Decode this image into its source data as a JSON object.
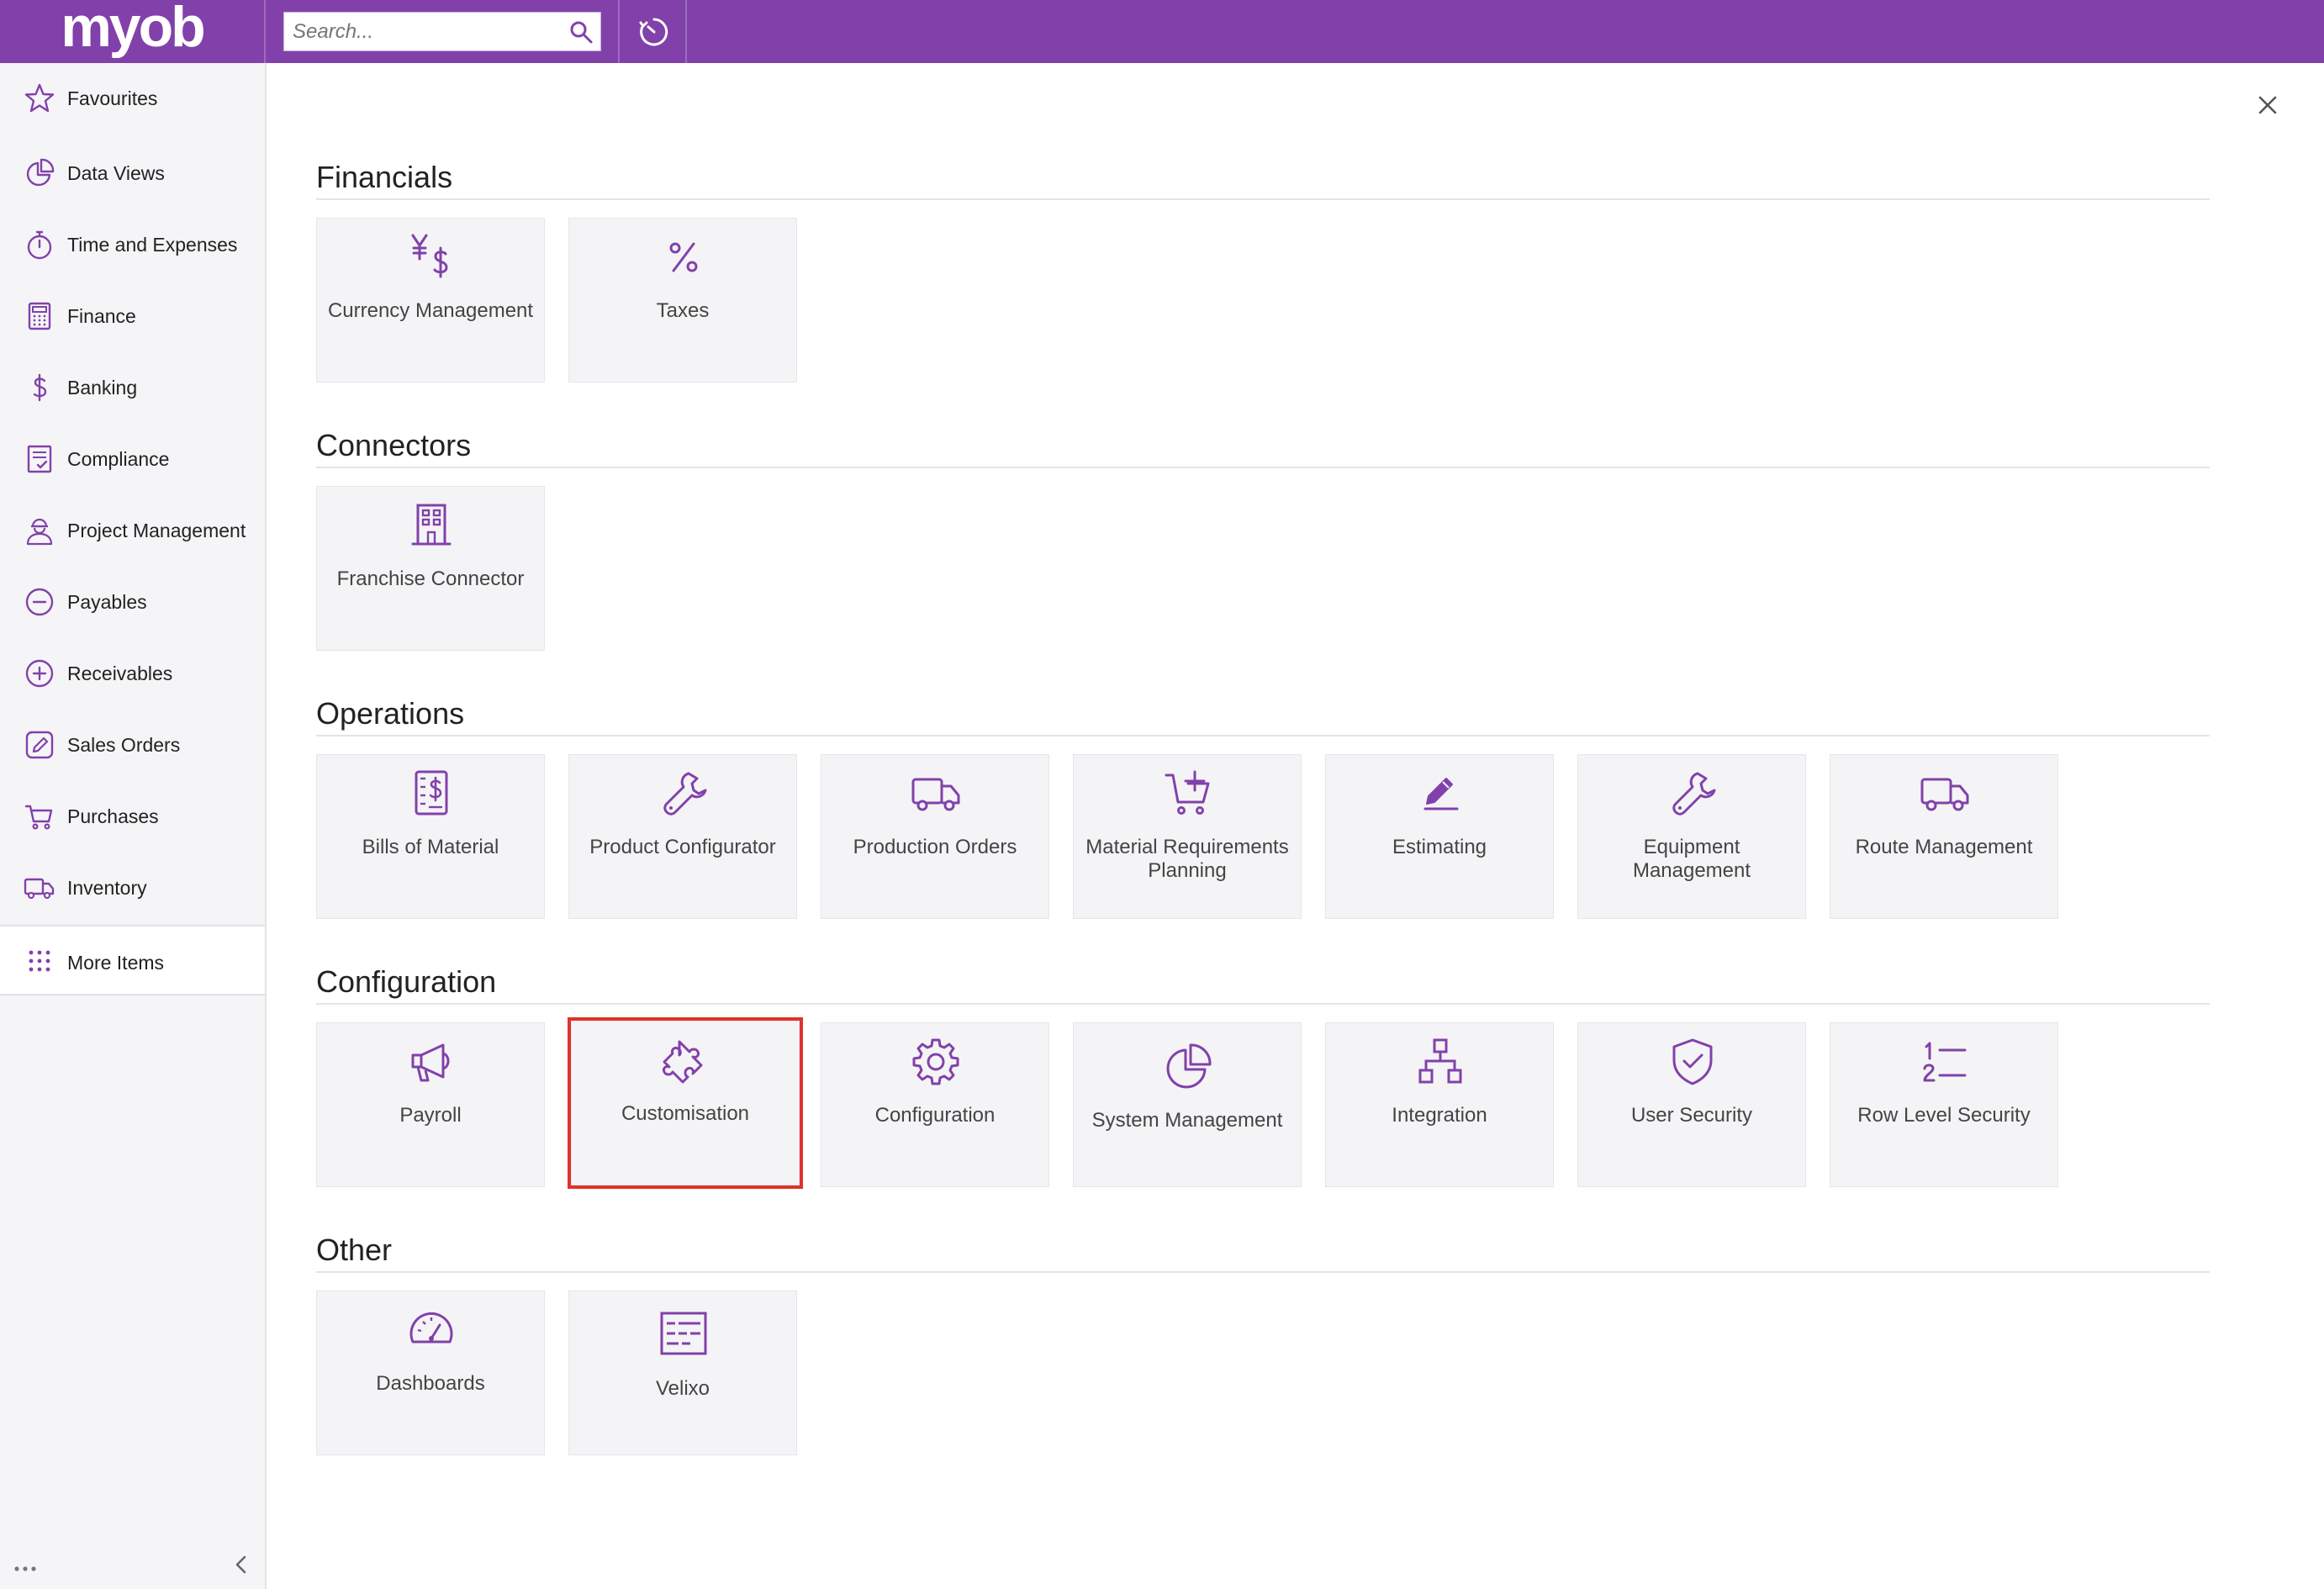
{
  "app": {
    "logo_text": "myob",
    "brand_color": "#8241aa",
    "highlight_color": "#e0322c"
  },
  "search": {
    "placeholder": "Search...",
    "value": ""
  },
  "sidebar": {
    "items": [
      {
        "label": "Favourites",
        "icon": "star-icon"
      },
      {
        "label": "Data Views",
        "icon": "pie-chart-icon"
      },
      {
        "label": "Time and Expenses",
        "icon": "stopwatch-icon"
      },
      {
        "label": "Finance",
        "icon": "calculator-icon"
      },
      {
        "label": "Banking",
        "icon": "dollar-icon"
      },
      {
        "label": "Compliance",
        "icon": "checklist-icon"
      },
      {
        "label": "Project Management",
        "icon": "worker-icon"
      },
      {
        "label": "Payables",
        "icon": "minus-circle-icon"
      },
      {
        "label": "Receivables",
        "icon": "plus-circle-icon"
      },
      {
        "label": "Sales Orders",
        "icon": "pencil-square-icon"
      },
      {
        "label": "Purchases",
        "icon": "cart-icon"
      },
      {
        "label": "Inventory",
        "icon": "truck-icon"
      }
    ],
    "more_items_label": "More Items"
  },
  "sections": {
    "financials": {
      "title": "Financials",
      "tiles": [
        {
          "label": "Currency Management",
          "icon": "currency-icon"
        },
        {
          "label": "Taxes",
          "icon": "percent-icon"
        }
      ]
    },
    "connectors": {
      "title": "Connectors",
      "tiles": [
        {
          "label": "Franchise Connector",
          "icon": "building-icon"
        }
      ]
    },
    "operations": {
      "title": "Operations",
      "tiles": [
        {
          "label": "Bills of Material",
          "icon": "bill-icon"
        },
        {
          "label": "Product Configurator",
          "icon": "wrench-icon"
        },
        {
          "label": "Production Orders",
          "icon": "truck-icon"
        },
        {
          "label": "Material Requirements Planning",
          "icon": "cart-plus-icon"
        },
        {
          "label": "Estimating",
          "icon": "pencil-icon"
        },
        {
          "label": "Equipment Management",
          "icon": "wrench-icon"
        },
        {
          "label": "Route Management",
          "icon": "truck-icon"
        }
      ]
    },
    "configuration": {
      "title": "Configuration",
      "tiles": [
        {
          "label": "Payroll",
          "icon": "megaphone-icon"
        },
        {
          "label": "Customisation",
          "icon": "puzzle-icon"
        },
        {
          "label": "Configuration",
          "icon": "gear-icon"
        },
        {
          "label": "System Management",
          "icon": "pie-chart-icon"
        },
        {
          "label": "Integration",
          "icon": "hierarchy-icon"
        },
        {
          "label": "User Security",
          "icon": "shield-check-icon"
        },
        {
          "label": "Row Level Security",
          "icon": "numbered-list-icon"
        }
      ]
    },
    "other": {
      "title": "Other",
      "tiles": [
        {
          "label": "Dashboards",
          "icon": "gauge-icon"
        },
        {
          "label": "Velixo",
          "icon": "spreadsheet-icon"
        }
      ]
    }
  }
}
